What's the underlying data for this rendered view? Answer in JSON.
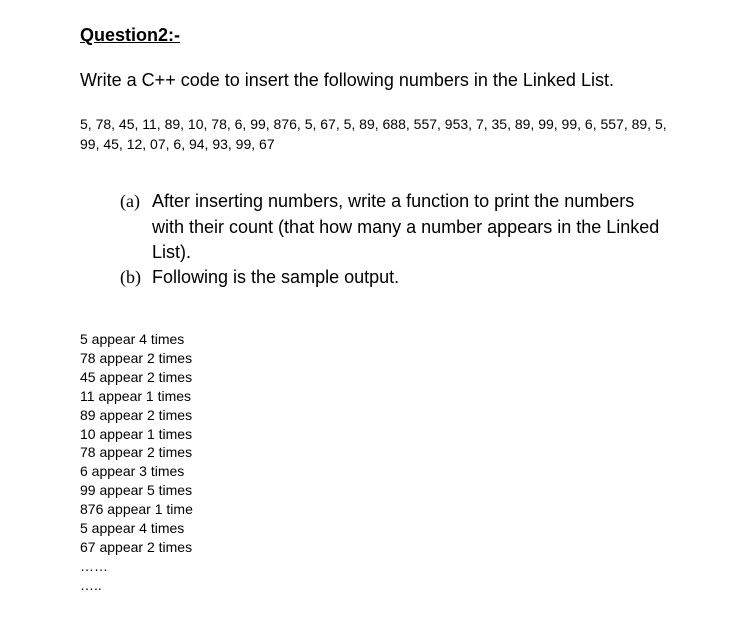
{
  "title": "Question2:-",
  "intro": "Write a C++ code to insert the following numbers in the Linked List.",
  "numbers": "5, 78, 45, 11, 89, 10, 78, 6, 99, 876, 5, 67, 5, 89, 688, 557, 953, 7, 35, 89, 99, 99, 6, 557, 89, 5, 99, 45, 12, 07, 6, 94, 93, 99, 67",
  "parts": {
    "a": {
      "label": "(a)",
      "text": "After inserting numbers, write a function to print the numbers with their count (that how many a number appears in the Linked List)."
    },
    "b": {
      "label": "(b)",
      "text": "Following is the sample output."
    }
  },
  "output": [
    "5 appear 4 times",
    "78 appear 2 times",
    "45 appear 2 times",
    "11 appear 1 times",
    "89 appear 2 times",
    "10 appear 1 times",
    "78 appear 2 times",
    "6 appear 3 times",
    "99 appear 5 times",
    "876 appear 1 time",
    "5 appear 4 times",
    "67 appear 2 times",
    "……",
    "….."
  ]
}
